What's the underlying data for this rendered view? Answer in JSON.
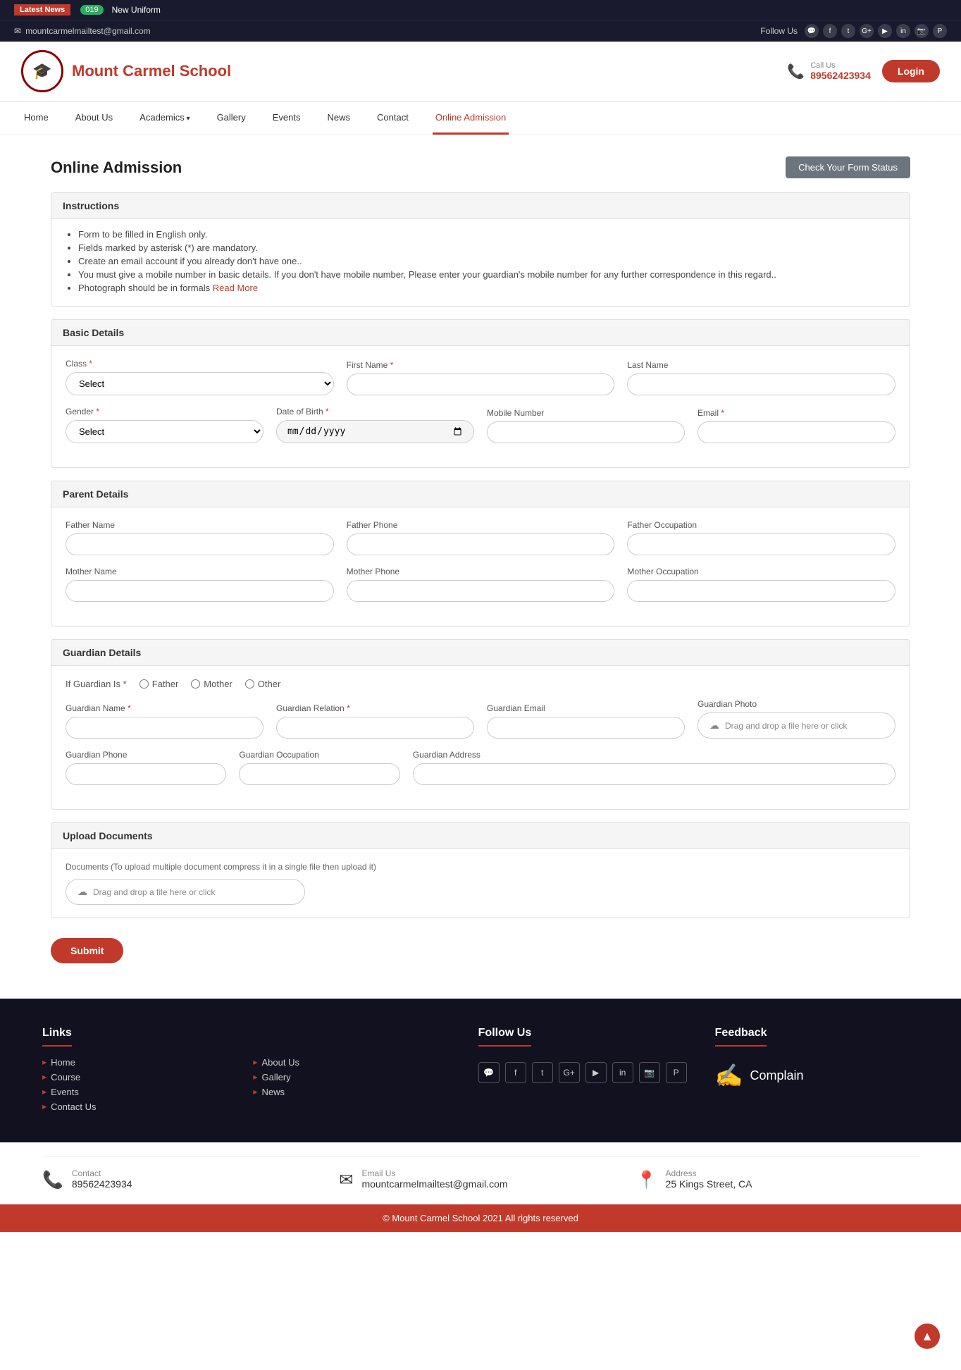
{
  "topbar": {
    "latest_news_label": "Latest News",
    "badge_count": "019",
    "badge_text": "New Uniform"
  },
  "contact_bar": {
    "email": "mountcarmelmailtest@gmail.com",
    "follow_label": "Follow Us"
  },
  "header": {
    "school_name": "Mount Carmel School",
    "call_label": "Call Us",
    "phone": "89562423934",
    "login_label": "Login"
  },
  "nav": {
    "items": [
      {
        "label": "Home",
        "active": false
      },
      {
        "label": "About Us",
        "active": false
      },
      {
        "label": "Academics",
        "active": false,
        "dropdown": true
      },
      {
        "label": "Gallery",
        "active": false
      },
      {
        "label": "Events",
        "active": false
      },
      {
        "label": "News",
        "active": false
      },
      {
        "label": "Contact",
        "active": false
      },
      {
        "label": "Online Admission",
        "active": true
      }
    ]
  },
  "page": {
    "title": "Online Admission",
    "check_status_btn": "Check Your Form Status"
  },
  "instructions": {
    "title": "Instructions",
    "items": [
      "Form to be filled in English only.",
      "Fields marked by asterisk (*) are mandatory.",
      "Create an email account if you already don't have one..",
      "You must give a mobile number in basic details. If you don't have mobile number, Please enter your guardian's mobile number for any further correspondence in this regard..",
      "Photograph should be in formals"
    ],
    "read_more": "Read More"
  },
  "basic_details": {
    "title": "Basic Details",
    "class_label": "Class",
    "class_required": true,
    "class_placeholder": "Select",
    "firstname_label": "First Name",
    "firstname_required": true,
    "lastname_label": "Last Name",
    "gender_label": "Gender",
    "gender_required": true,
    "gender_placeholder": "Select",
    "dob_label": "Date of Birth",
    "dob_required": true,
    "mobile_label": "Mobile Number",
    "email_label": "Email",
    "email_required": true
  },
  "parent_details": {
    "title": "Parent Details",
    "father_name_label": "Father Name",
    "father_phone_label": "Father Phone",
    "father_occ_label": "Father Occupation",
    "mother_name_label": "Mother Name",
    "mother_phone_label": "Mother Phone",
    "mother_occ_label": "Mother Occupation"
  },
  "guardian_details": {
    "title": "Guardian Details",
    "if_guardian_label": "If Guardian Is",
    "required": true,
    "options": [
      "Father",
      "Mother",
      "Other"
    ],
    "name_label": "Guardian Name",
    "name_required": true,
    "relation_label": "Guardian Relation",
    "relation_required": true,
    "email_label": "Guardian Email",
    "photo_label": "Guardian Photo",
    "photo_upload": "Drag and drop a file here or click",
    "phone_label": "Guardian Phone",
    "occupation_label": "Guardian Occupation",
    "address_label": "Guardian Address"
  },
  "upload_documents": {
    "title": "Upload Documents",
    "note": "Documents (To upload multiple document compress it in a single file then upload it)",
    "upload_text": "Drag and drop a file here or click"
  },
  "form_actions": {
    "submit_label": "Submit"
  },
  "footer": {
    "links_title": "Links",
    "links_col1": [
      "Home",
      "Course",
      "Events",
      "Contact Us"
    ],
    "links_col2": [
      "About Us",
      "Gallery",
      "News"
    ],
    "follow_title": "Follow Us",
    "feedback_title": "Feedback",
    "complain_label": "Complain",
    "contact_title": "Contact",
    "contact_value": "89562423934",
    "email_title": "Email Us",
    "email_value": "mountcarmelmailtest@gmail.com",
    "address_title": "Address",
    "address_value": "25 Kings Street, CA",
    "copyright": "© Mount Carmel School 2021 All rights reserved"
  }
}
